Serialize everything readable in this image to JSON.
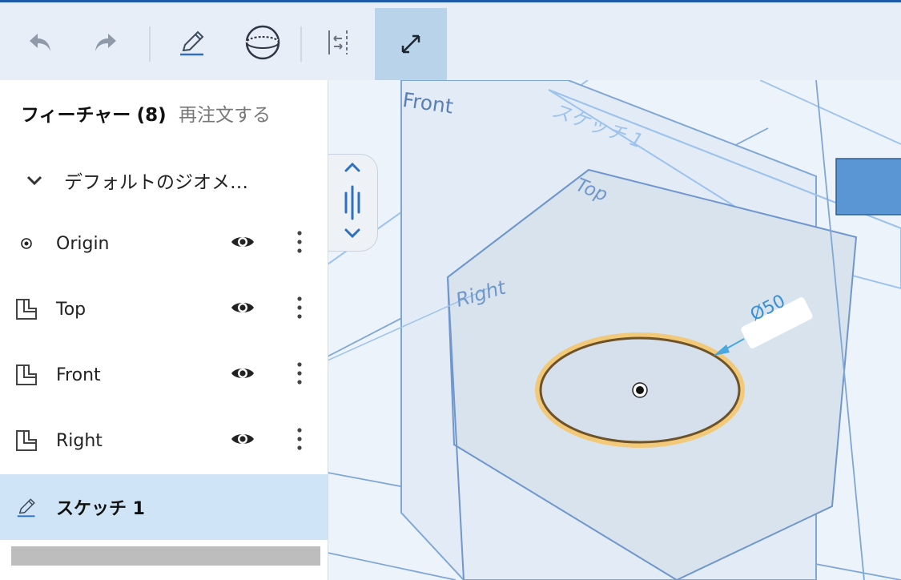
{
  "toolbar": {
    "buttons": [
      {
        "name": "undo",
        "icon": "undo-icon"
      },
      {
        "name": "redo",
        "icon": "redo-icon"
      },
      {
        "name": "sketch",
        "icon": "pencil-icon"
      },
      {
        "name": "primitive",
        "icon": "sphere-icon"
      },
      {
        "name": "mate-connector",
        "icon": "split-view-icon"
      },
      {
        "name": "measure",
        "icon": "measure-icon",
        "active": true
      }
    ],
    "accent": "#1e5aa6"
  },
  "feature_panel": {
    "title": "フィーチャー",
    "count": "(8)",
    "reorder_link": "再注文する",
    "group_label": "デフォルトのジオメ…",
    "items": [
      {
        "label": "Origin",
        "icon": "origin-icon",
        "visible": true
      },
      {
        "label": "Top",
        "icon": "plane-icon",
        "visible": true
      },
      {
        "label": "Front",
        "icon": "plane-icon",
        "visible": true
      },
      {
        "label": "Right",
        "icon": "plane-icon",
        "visible": true
      },
      {
        "label": "スケッチ 1",
        "icon": "pencil-icon",
        "selected": true
      }
    ]
  },
  "viewport": {
    "plane_labels": {
      "front": "Front",
      "top": "Top",
      "right": "Right",
      "sketch": "スケッチ 1"
    },
    "dimension": "Ø50",
    "colors": {
      "plane_edge": "#5b86c2",
      "circle_outer": "#e3b25a",
      "circle_inner": "#7a5a2c",
      "fill": "#d6e0ec",
      "view_cube": "#5a96d3"
    }
  }
}
